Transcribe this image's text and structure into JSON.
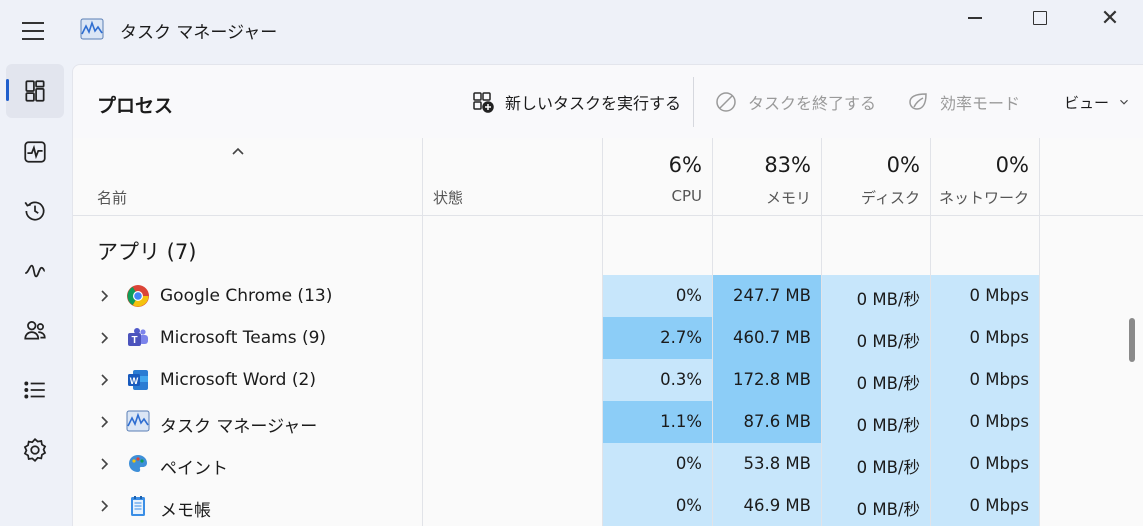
{
  "window": {
    "title": "タスク マネージャー",
    "minimize_label": "",
    "maximize_label": "",
    "close_label": "✕"
  },
  "nav": {
    "items": [
      {
        "name": "processes",
        "icon": "processes-icon",
        "active": true
      },
      {
        "name": "performance",
        "icon": "performance-icon",
        "active": false
      },
      {
        "name": "app-history",
        "icon": "history-icon",
        "active": false
      },
      {
        "name": "startup",
        "icon": "startup-icon",
        "active": false
      },
      {
        "name": "users",
        "icon": "users-icon",
        "active": false
      },
      {
        "name": "details",
        "icon": "details-icon",
        "active": false
      },
      {
        "name": "services",
        "icon": "services-icon",
        "active": false
      }
    ]
  },
  "toolbar": {
    "page_title": "プロセス",
    "new_task": "新しいタスクを実行する",
    "end_task": "タスクを終了する",
    "efficiency": "効率モード",
    "view": "ビュー"
  },
  "table": {
    "col_name": "名前",
    "col_status": "状態",
    "cpu_pct": "6%",
    "cpu_label": "CPU",
    "mem_pct": "83%",
    "mem_label": "メモリ",
    "disk_pct": "0%",
    "disk_label": "ディスク",
    "net_pct": "0%",
    "net_label": "ネットワーク",
    "group_label": "アプリ (7)",
    "rows": [
      {
        "name": "Google Chrome (13)",
        "icon": "chrome-icon",
        "cpu": "0%",
        "mem": "247.7 MB",
        "disk": "0 MB/秒",
        "net": "0 Mbps",
        "cpu_level": "low",
        "mem_level": "high"
      },
      {
        "name": "Microsoft Teams (9)",
        "icon": "teams-icon",
        "cpu": "2.7%",
        "mem": "460.7 MB",
        "disk": "0 MB/秒",
        "net": "0 Mbps",
        "cpu_level": "high",
        "mem_level": "high"
      },
      {
        "name": "Microsoft Word (2)",
        "icon": "word-icon",
        "cpu": "0.3%",
        "mem": "172.8 MB",
        "disk": "0 MB/秒",
        "net": "0 Mbps",
        "cpu_level": "low",
        "mem_level": "high"
      },
      {
        "name": "タスク マネージャー",
        "icon": "task-manager-icon",
        "cpu": "1.1%",
        "mem": "87.6 MB",
        "disk": "0 MB/秒",
        "net": "0 Mbps",
        "cpu_level": "high",
        "mem_level": "high"
      },
      {
        "name": "ペイント",
        "icon": "paint-icon",
        "cpu": "0%",
        "mem": "53.8 MB",
        "disk": "0 MB/秒",
        "net": "0 Mbps",
        "cpu_level": "low",
        "mem_level": "low"
      },
      {
        "name": "メモ帳",
        "icon": "notepad-icon",
        "cpu": "0%",
        "mem": "46.9 MB",
        "disk": "0 MB/秒",
        "net": "0 Mbps",
        "cpu_level": "low",
        "mem_level": "low"
      }
    ]
  },
  "colors": {
    "heat_low": "#c7e6fb",
    "heat_high": "#8ccdf7",
    "accent": "#1f5ecc"
  }
}
